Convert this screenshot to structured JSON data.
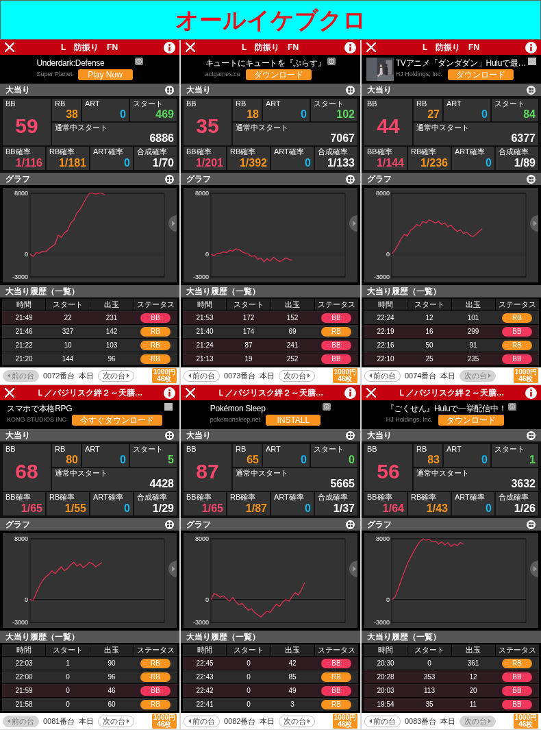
{
  "title": "オールイケブクロ",
  "panels": [
    {
      "machine_title": "L　防振り　FN",
      "ad": {
        "headline": "Underdark:Defense",
        "advertiser": "Super Planet",
        "cta": "Play Now",
        "choice_icon": {
          "kind": "info"
        }
      },
      "stats": {
        "label": "大当り",
        "top": [
          {
            "kind": "bb",
            "label": "BB",
            "value": "59"
          },
          {
            "kind": "rb",
            "label": "RB",
            "value": "38"
          },
          {
            "kind": "art",
            "label": "ART",
            "value": "0"
          },
          {
            "kind": "start",
            "label": "スタート",
            "value": "469"
          },
          {
            "kind": "plain",
            "label": "通常中スタート",
            "value": "6886"
          }
        ],
        "rates": [
          {
            "kind": "bb",
            "label": "BB確率",
            "value": "1/116"
          },
          {
            "kind": "rb",
            "label": "RB確率",
            "value": "1/181"
          },
          {
            "kind": "art",
            "label": "ART確率",
            "value": "0"
          },
          {
            "kind": "plain",
            "label": "合成確率",
            "value": "1/70"
          }
        ]
      },
      "graph": {
        "label": "グラフ",
        "chart_data": {
          "type": "line",
          "ylim": [
            -3000,
            8000
          ],
          "yticks": [
            8000,
            0,
            -3000
          ],
          "series": [
            {
              "color": "#e8304f",
              "values": [
                0,
                -300,
                200,
                100,
                400,
                300,
                700,
                1000,
                1300,
                2500,
                2200,
                2800,
                3100,
                4100,
                4500,
                5400,
                5900,
                6600,
                7400,
                8000,
                8000,
                7900,
                8000,
                8000,
                7800,
                null,
                null,
                null,
                null,
                null,
                null,
                null,
                null,
                null,
                null,
                null,
                null,
                null,
                null,
                null,
                null,
                null,
                null,
                null
              ]
            }
          ]
        }
      },
      "history": {
        "label": "大当り履歴（一覧）",
        "columns": [
          "時間",
          "スタート",
          "出玉",
          "ステータス"
        ],
        "rows": [
          {
            "cells": [
              "21:49",
              "22",
              "231"
            ],
            "status": "BB",
            "kind": "bb"
          },
          {
            "cells": [
              "21:46",
              "327",
              "142"
            ],
            "status": "RB",
            "kind": "rb"
          },
          {
            "cells": [
              "21:22",
              "10",
              "103"
            ],
            "status": "RB",
            "kind": "rb"
          },
          {
            "cells": [
              "21:20",
              "144",
              "96"
            ],
            "status": "RB",
            "kind": "rb"
          }
        ]
      },
      "footer": {
        "prev": {
          "label": "前の台",
          "disabled": true
        },
        "machine_no": "0072番台",
        "day": "本日",
        "next": {
          "label": "次の台",
          "disabled": false
        },
        "badge": [
          "1000円",
          "46枚"
        ]
      }
    },
    {
      "machine_title": "L　防振り　FN",
      "ad": {
        "headline": "キュートにキュートを『ぷらす』",
        "advertiser": "actgames.co",
        "cta": "ダウンロード",
        "choice_icon": {
          "kind": "info"
        }
      },
      "stats": {
        "label": "大当り",
        "top": [
          {
            "kind": "bb",
            "label": "BB",
            "value": "35"
          },
          {
            "kind": "rb",
            "label": "RB",
            "value": "18"
          },
          {
            "kind": "art",
            "label": "ART",
            "value": "0"
          },
          {
            "kind": "start",
            "label": "スタート",
            "value": "102"
          },
          {
            "kind": "plain",
            "label": "通常中スタート",
            "value": "7067"
          }
        ],
        "rates": [
          {
            "kind": "bb",
            "label": "BB確率",
            "value": "1/201"
          },
          {
            "kind": "rb",
            "label": "RB確率",
            "value": "1/392"
          },
          {
            "kind": "art",
            "label": "ART確率",
            "value": "0"
          },
          {
            "kind": "plain",
            "label": "合成確率",
            "value": "1/133"
          }
        ]
      },
      "graph": {
        "label": "グラフ",
        "chart_data": {
          "type": "line",
          "ylim": [
            -3000,
            8000
          ],
          "yticks": [
            8000,
            0,
            -3000
          ],
          "series": [
            {
              "color": "#e8304f",
              "values": [
                0,
                -200,
                100,
                100,
                300,
                200,
                500,
                400,
                700,
                600,
                300,
                100,
                0,
                -300,
                -200,
                -700,
                -500,
                -1000,
                -600,
                -900,
                -400,
                -700,
                -1000,
                -800,
                -500,
                -700,
                -800,
                null,
                null,
                null,
                null,
                null,
                null,
                null,
                null,
                null,
                null,
                null,
                null,
                null,
                null,
                null,
                null,
                null
              ]
            }
          ]
        }
      },
      "history": {
        "label": "大当り履歴（一覧）",
        "columns": [
          "時間",
          "スタート",
          "出玉",
          "ステータス"
        ],
        "rows": [
          {
            "cells": [
              "21:53",
              "172",
              "152"
            ],
            "status": "BB",
            "kind": "bb"
          },
          {
            "cells": [
              "21:40",
              "174",
              "69"
            ],
            "status": "RB",
            "kind": "rb"
          },
          {
            "cells": [
              "21:24",
              "87",
              "241"
            ],
            "status": "BB",
            "kind": "bb"
          },
          {
            "cells": [
              "21:13",
              "19",
              "252"
            ],
            "status": "BB",
            "kind": "bb"
          }
        ]
      },
      "footer": {
        "prev": {
          "label": "前の台",
          "disabled": false
        },
        "machine_no": "0073番台",
        "day": "本日",
        "next": {
          "label": "次の台",
          "disabled": false
        },
        "badge": [
          "1000円",
          "46枚"
        ]
      }
    },
    {
      "machine_title": "L　防振り　FN",
      "ad": {
        "headline": "TVアニメ「ダンダダン」Huluで最…",
        "advertiser": "HJ Holdings, Inc.",
        "cta": "ダウンロード",
        "choice_icon": {
          "kind": "blank"
        }
      },
      "stats": {
        "label": "大当り",
        "top": [
          {
            "kind": "bb",
            "label": "BB",
            "value": "44"
          },
          {
            "kind": "rb",
            "label": "RB",
            "value": "27"
          },
          {
            "kind": "art",
            "label": "ART",
            "value": "0"
          },
          {
            "kind": "start",
            "label": "スタート",
            "value": "84"
          },
          {
            "kind": "plain",
            "label": "通常中スタート",
            "value": "6377"
          }
        ],
        "rates": [
          {
            "kind": "bb",
            "label": "BB確率",
            "value": "1/144"
          },
          {
            "kind": "rb",
            "label": "RB確率",
            "value": "1/236"
          },
          {
            "kind": "art",
            "label": "ART確率",
            "value": "0"
          },
          {
            "kind": "plain",
            "label": "合成確率",
            "value": "1/89"
          }
        ]
      },
      "graph": {
        "label": "グラフ",
        "chart_data": {
          "type": "line",
          "ylim": [
            -3000,
            8000
          ],
          "yticks": [
            8000,
            0,
            -3000
          ],
          "series": [
            {
              "color": "#e8304f",
              "values": [
                0,
                500,
                1200,
                2000,
                2600,
                2400,
                3100,
                3400,
                3900,
                3700,
                4300,
                4100,
                4500,
                4300,
                4100,
                4300,
                3900,
                4100,
                3600,
                3800,
                3300,
                3000,
                3200,
                2700,
                2900,
                2500,
                2300,
                2600,
                3000,
                3300,
                null,
                null,
                null,
                null,
                null,
                null,
                null,
                null,
                null,
                null,
                null,
                null,
                null,
                null
              ]
            }
          ]
        }
      },
      "history": {
        "label": "大当り履歴（一覧）",
        "columns": [
          "時間",
          "スタート",
          "出玉",
          "ステータス"
        ],
        "rows": [
          {
            "cells": [
              "22:24",
              "12",
              "101"
            ],
            "status": "RB",
            "kind": "rb"
          },
          {
            "cells": [
              "22:19",
              "16",
              "299"
            ],
            "status": "BB",
            "kind": "bb"
          },
          {
            "cells": [
              "22:16",
              "50",
              "91"
            ],
            "status": "RB",
            "kind": "rb"
          },
          {
            "cells": [
              "22:10",
              "25",
              "235"
            ],
            "status": "BB",
            "kind": "bb"
          }
        ]
      },
      "footer": {
        "prev": {
          "label": "前の台",
          "disabled": false
        },
        "machine_no": "0074番台",
        "day": "本日",
        "next": {
          "label": "次の台",
          "disabled": true
        },
        "badge": [
          "1000円",
          "46枚"
        ]
      }
    },
    {
      "machine_title": "Ｌ／バジリスク絆２～天膳…",
      "ad": {
        "headline": "スマホで本格RPG",
        "advertiser": "KONG STUDIOS INC",
        "cta": "今すぐダウンロード",
        "choice_icon": {
          "kind": "blank"
        }
      },
      "stats": {
        "label": "大当り",
        "top": [
          {
            "kind": "bb",
            "label": "BB",
            "value": "68"
          },
          {
            "kind": "rb",
            "label": "RB",
            "value": "80"
          },
          {
            "kind": "art",
            "label": "ART",
            "value": "0"
          },
          {
            "kind": "start",
            "label": "スタート",
            "value": "5"
          },
          {
            "kind": "plain",
            "label": "通常中スタート",
            "value": "4428"
          }
        ],
        "rates": [
          {
            "kind": "bb",
            "label": "BB確率",
            "value": "1/65"
          },
          {
            "kind": "rb",
            "label": "RB確率",
            "value": "1/55"
          },
          {
            "kind": "art",
            "label": "ART確率",
            "value": "0"
          },
          {
            "kind": "plain",
            "label": "合成確率",
            "value": "1/29"
          }
        ]
      },
      "graph": {
        "label": "グラフ",
        "chart_data": {
          "type": "line",
          "ylim": [
            -3000,
            8000
          ],
          "yticks": [
            8000,
            0,
            -3000
          ],
          "series": [
            {
              "color": "#e8304f",
              "values": [
                0,
                -100,
                900,
                1800,
                2500,
                3000,
                3300,
                3800,
                3400,
                3900,
                4300,
                3800,
                4100,
                4600,
                4900,
                4400,
                4700,
                4200,
                4500,
                4900,
                4700,
                4300,
                4600,
                4900,
                null,
                null,
                null,
                null,
                null,
                null,
                null,
                null,
                null,
                null,
                null,
                null,
                null,
                null,
                null,
                null,
                null,
                null,
                null,
                null
              ]
            }
          ]
        }
      },
      "history": {
        "label": "大当り履歴（一覧）",
        "columns": [
          "時間",
          "スタート",
          "出玉",
          "ステータス"
        ],
        "rows": [
          {
            "cells": [
              "22:03",
              "1",
              "90"
            ],
            "status": "RB",
            "kind": "rb"
          },
          {
            "cells": [
              "22:00",
              "0",
              "96"
            ],
            "status": "RB",
            "kind": "rb"
          },
          {
            "cells": [
              "21:59",
              "0",
              "46"
            ],
            "status": "BB",
            "kind": "bb"
          },
          {
            "cells": [
              "21:58",
              "0",
              "60"
            ],
            "status": "RB",
            "kind": "rb"
          }
        ]
      },
      "footer": {
        "prev": {
          "label": "前の台",
          "disabled": true
        },
        "machine_no": "0081番台",
        "day": "本日",
        "next": {
          "label": "次の台",
          "disabled": false
        },
        "badge": [
          "1000円",
          "46枚"
        ]
      }
    },
    {
      "machine_title": "Ｌ／バジリスク絆２～天膳…",
      "ad": {
        "headline": "Pokémon Sleep",
        "advertiser": "pokemonsleep.net",
        "cta": "INSTALL",
        "choice_icon": {
          "kind": "info"
        }
      },
      "stats": {
        "label": "大当り",
        "top": [
          {
            "kind": "bb",
            "label": "BB",
            "value": "87"
          },
          {
            "kind": "rb",
            "label": "RB",
            "value": "65"
          },
          {
            "kind": "art",
            "label": "ART",
            "value": "0"
          },
          {
            "kind": "start",
            "label": "スタート",
            "value": "0"
          },
          {
            "kind": "plain",
            "label": "通常中スタート",
            "value": "5665"
          }
        ],
        "rates": [
          {
            "kind": "bb",
            "label": "BB確率",
            "value": "1/65"
          },
          {
            "kind": "rb",
            "label": "RB確率",
            "value": "1/87"
          },
          {
            "kind": "art",
            "label": "ART確率",
            "value": "0"
          },
          {
            "kind": "plain",
            "label": "合成確率",
            "value": "1/37"
          }
        ]
      },
      "graph": {
        "label": "グラフ",
        "chart_data": {
          "type": "line",
          "ylim": [
            -3000,
            8000
          ],
          "yticks": [
            8000,
            0,
            -3000
          ],
          "series": [
            {
              "color": "#e8304f",
              "values": [
                0,
                800,
                600,
                300,
                500,
                100,
                -200,
                300,
                -300,
                -700,
                -500,
                -1000,
                -1400,
                -1200,
                -1700,
                -2000,
                -2300,
                -1900,
                -1500,
                -1700,
                -1100,
                -600,
                -900,
                -300,
                0,
                -200,
                400,
                900,
                600,
                1300,
                2200,
                null,
                null,
                null,
                null,
                null,
                null,
                null,
                null,
                null,
                null,
                null,
                null,
                null
              ]
            }
          ]
        }
      },
      "history": {
        "label": "大当り履歴（一覧）",
        "columns": [
          "時間",
          "スタート",
          "出玉",
          "ステータス"
        ],
        "rows": [
          {
            "cells": [
              "22:45",
              "0",
              "42"
            ],
            "status": "BB",
            "kind": "bb"
          },
          {
            "cells": [
              "22:43",
              "0",
              "85"
            ],
            "status": "RB",
            "kind": "rb"
          },
          {
            "cells": [
              "22:42",
              "0",
              "49"
            ],
            "status": "BB",
            "kind": "bb"
          },
          {
            "cells": [
              "22:41",
              "0",
              "3"
            ],
            "status": "RB",
            "kind": "rb"
          }
        ]
      },
      "footer": {
        "prev": {
          "label": "前の台",
          "disabled": false
        },
        "machine_no": "0082番台",
        "day": "本日",
        "next": {
          "label": "次の台",
          "disabled": false
        },
        "badge": [
          "1000円",
          "46枚"
        ]
      }
    },
    {
      "machine_title": "Ｌ／バジリスク絆２～天膳…",
      "ad": {
        "headline": "『ごくせん』Huluで一挙配信中！",
        "advertiser": "HJ Holdings, Inc.",
        "cta": "ダウンロード",
        "choice_icon": {
          "kind": "info"
        }
      },
      "stats": {
        "label": "大当り",
        "top": [
          {
            "kind": "bb",
            "label": "BB",
            "value": "56"
          },
          {
            "kind": "rb",
            "label": "RB",
            "value": "83"
          },
          {
            "kind": "art",
            "label": "ART",
            "value": "0"
          },
          {
            "kind": "start",
            "label": "スタート",
            "value": "1"
          },
          {
            "kind": "plain",
            "label": "通常中スタート",
            "value": "3632"
          }
        ],
        "rates": [
          {
            "kind": "bb",
            "label": "BB確率",
            "value": "1/64"
          },
          {
            "kind": "rb",
            "label": "RB確率",
            "value": "1/43"
          },
          {
            "kind": "art",
            "label": "ART確率",
            "value": "0"
          },
          {
            "kind": "plain",
            "label": "合成確率",
            "value": "1/26"
          }
        ]
      },
      "graph": {
        "label": "グラフ",
        "chart_data": {
          "type": "line",
          "ylim": [
            -3000,
            8000
          ],
          "yticks": [
            8000,
            0,
            -3000
          ],
          "series": [
            {
              "color": "#e8304f",
              "values": [
                0,
                300,
                1300,
                2500,
                3600,
                4700,
                5500,
                6300,
                7000,
                7600,
                8000,
                7800,
                7900,
                7600,
                7700,
                7300,
                7600,
                7200,
                7500,
                7000,
                7300,
                7100,
                7500,
                7300,
                null,
                null,
                null,
                null,
                null,
                null,
                null,
                null,
                null,
                null,
                null,
                null,
                null,
                null,
                null,
                null,
                null,
                null,
                null,
                null
              ]
            }
          ]
        }
      },
      "history": {
        "label": "大当り履歴（一覧）",
        "columns": [
          "時間",
          "スタート",
          "出玉",
          "ステータス"
        ],
        "rows": [
          {
            "cells": [
              "20:30",
              "0",
              "361"
            ],
            "status": "RB",
            "kind": "rb"
          },
          {
            "cells": [
              "20:28",
              "353",
              "12"
            ],
            "status": "BB",
            "kind": "bb"
          },
          {
            "cells": [
              "20:03",
              "113",
              "20"
            ],
            "status": "BB",
            "kind": "bb"
          },
          {
            "cells": [
              "19:54",
              "35",
              "11"
            ],
            "status": "BB",
            "kind": "bb"
          }
        ]
      },
      "footer": {
        "prev": {
          "label": "前の台",
          "disabled": false
        },
        "machine_no": "0083番台",
        "day": "本日",
        "next": {
          "label": "次の台",
          "disabled": true
        },
        "badge": [
          "1000円",
          "46枚"
        ]
      }
    }
  ]
}
